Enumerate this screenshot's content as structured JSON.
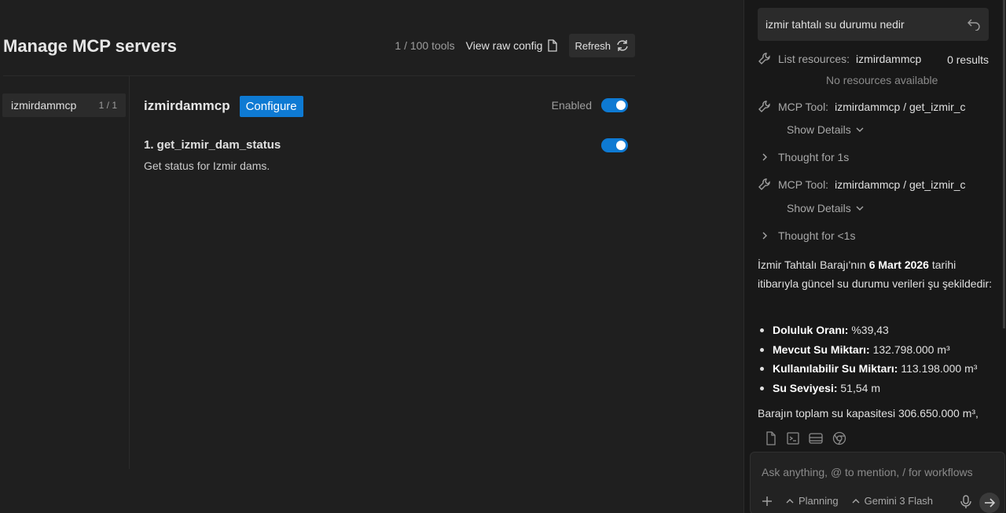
{
  "header": {
    "title": "Manage MCP servers",
    "tools_count": "1 / 100 tools",
    "view_raw_config": "View raw config",
    "refresh": "Refresh"
  },
  "servers": [
    {
      "name": "izmirdammcp",
      "count": "1 / 1"
    }
  ],
  "server_detail": {
    "name": "izmirdammcp",
    "configure": "Configure",
    "enabled_label": "Enabled",
    "enabled": true,
    "tools": [
      {
        "name": "1. get_izmir_dam_status",
        "description": "Get status for Izmir dams.",
        "enabled": true
      }
    ]
  },
  "chat": {
    "query": "izmir tahtalı su durumu nedir",
    "steps": [
      {
        "icon": "wrench-icon",
        "label": "List resources:",
        "value": "izmirdammcp",
        "results": "0 results",
        "note": "No resources available"
      },
      {
        "icon": "wrench-icon",
        "label": "MCP Tool:",
        "value": "izmirdammcp / get_izmir_c",
        "details": "Show Details"
      },
      {
        "icon": "chevron-right-icon",
        "label": "Thought for 1s"
      },
      {
        "icon": "wrench-icon",
        "label": "MCP Tool:",
        "value": "izmirdammcp / get_izmir_c",
        "details": "Show Details"
      },
      {
        "icon": "chevron-right-icon",
        "label": "Thought for <1s"
      }
    ],
    "answer": {
      "intro_prefix": "İzmir Tahtalı Barajı'nın ",
      "intro_bold": "6 Mart 2026",
      "intro_suffix": " tarihi itibarıyla güncel su durumu verileri şu şekildedir:",
      "bullets": [
        {
          "label": "Doluluk Oranı:",
          "value": " %39,43"
        },
        {
          "label": "Mevcut Su Miktarı:",
          "value": " 132.798.000 m³"
        },
        {
          "label": "Kullanılabilir Su Miktarı:",
          "value": " 113.198.000 m³"
        },
        {
          "label": "Su Seviyesi:",
          "value": " 51,54 m"
        }
      ],
      "trailing": "Barajın toplam su kapasitesi 306.650.000 m³,"
    },
    "input": {
      "placeholder": "Ask anything, @ to mention, / for workflows",
      "mode": "Planning",
      "model": "Gemini 3 Flash"
    }
  },
  "colors": {
    "accent": "#0e7ad3",
    "background": "#1f1f1f",
    "panel": "#181818"
  }
}
